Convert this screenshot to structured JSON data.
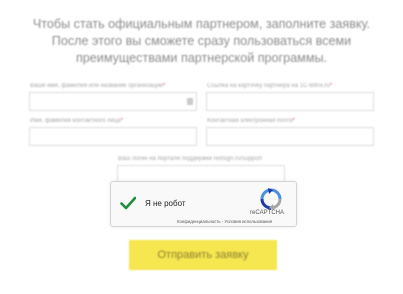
{
  "intro": {
    "line1": "Чтобы стать официальным партнером, заполните заявку.",
    "line2": "После этого вы сможете сразу пользоваться всеми",
    "line3": "преимуществами партнерской программы."
  },
  "form": {
    "name_org": {
      "label": "Ваше имя, фамилия или название организации",
      "required": "*",
      "value": ""
    },
    "partner_card": {
      "label": "Ссылка на карточку партнера на 1С-Bitrix.ru",
      "required": "*",
      "value": ""
    },
    "contact_name": {
      "label": "Имя, фамилия контактного лица",
      "required": "*",
      "value": ""
    },
    "contact_email": {
      "label": "Контактная электронная почта",
      "required": "*",
      "value": ""
    },
    "support_login": {
      "label": "Ваш логин на портале поддержки redsign.ru/support",
      "value": ""
    }
  },
  "captcha": {
    "label": "Я не робот",
    "brand": "reCAPTCHA",
    "terms": "Конфиденциальность - Условия использования",
    "check_color": "#1e8e3e",
    "check_icon": "checkmark-icon",
    "logo_icon": "recaptcha-logo-icon"
  },
  "submit": {
    "label": "Отправить заявку",
    "color": "#f6e64f"
  }
}
